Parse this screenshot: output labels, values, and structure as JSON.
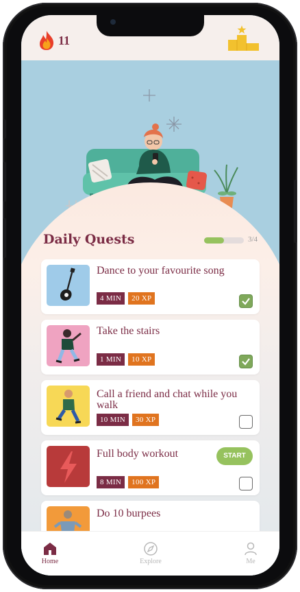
{
  "status": {
    "streak_count": "11"
  },
  "quests": {
    "title": "Daily Quests",
    "progress_label": "3/4",
    "progress_fraction": 0.5,
    "items": [
      {
        "title": "Dance to your favourite song",
        "time": "4 MIN",
        "xp": "20 XP",
        "done": true
      },
      {
        "title": "Take the stairs",
        "time": "1 MIN",
        "xp": "10 XP",
        "done": true
      },
      {
        "title": "Call a friend and chat while you walk",
        "time": "10 MIN",
        "xp": "30 XP",
        "done": false
      },
      {
        "title": "Full body workout",
        "time": "8 MIN",
        "xp": "100 XP",
        "done": false,
        "action": "START"
      },
      {
        "title": "Do 10 burpees"
      }
    ]
  },
  "nav": {
    "home": "Home",
    "explore": "Explore",
    "me": "Me"
  },
  "colors": {
    "accent": "#7b2c45",
    "xp": "#e0741f",
    "success": "#96c25e",
    "sky": "#a9cfe0"
  }
}
